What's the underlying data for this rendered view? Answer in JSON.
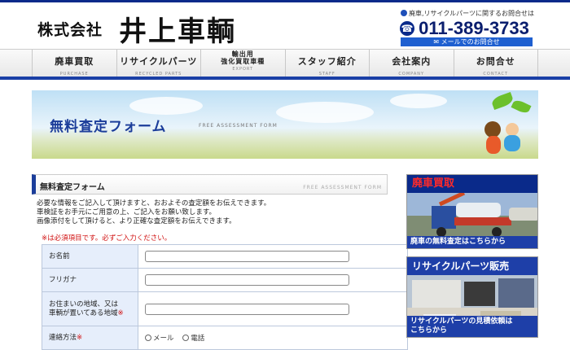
{
  "header": {
    "company_small": "株式会社",
    "company_big": "井上車輌",
    "contact_note": "廃車,リサイクルパーツに関するお問合せは",
    "phone": "011-389-3733",
    "mail_button": "メールでのお問合せ"
  },
  "nav": {
    "items": [
      {
        "jp": "廃車買取",
        "en": "PURCHASE"
      },
      {
        "jp": "リサイクルパーツ",
        "en": "RECYCLED PARTS"
      },
      {
        "jp": "輸出用\n強化買取車種",
        "en": "EXPORT"
      },
      {
        "jp": "スタッフ紹介",
        "en": "STAFF"
      },
      {
        "jp": "会社案内",
        "en": "COMPANY"
      },
      {
        "jp": "お問合せ",
        "en": "CONTACT"
      }
    ]
  },
  "banner": {
    "title": "無料査定フォーム",
    "subtitle": "FREE ASSESSMENT FORM"
  },
  "section": {
    "title": "無料査定フォーム",
    "en": "FREE ASSESSMENT FORM",
    "intro": [
      "必要な情報をご記入して頂けますと、おおよその査定額をお伝えできます。",
      "車検証をお手元にご用意の上、ご記入をお願い致します。",
      "画像添付をして頂けると、より正確な査定額をお伝えできます。"
    ],
    "required_note": "※は必須項目です。必ずご入力ください。"
  },
  "form": {
    "name_label": "お名前",
    "furigana_label": "フリガナ",
    "address_label_1": "お住まいの地域、又は",
    "address_label_2": "車輌が置いてある地域",
    "contact_label": "連絡方法",
    "required_mark": "※",
    "contact_options": [
      "メール",
      "電話"
    ]
  },
  "side": {
    "box1_title": "廃車買取",
    "box1_caption": "廃車の無料査定はこちらから",
    "box2_title": "リサイクルパーツ販売",
    "box2_caption": "リサイクルパーツの見積依頼は\nこちらから"
  },
  "colors": {
    "brand_navy": "#0a2a8a",
    "accent_blue": "#1e3fa8",
    "required_red": "#d01010",
    "form_label_bg": "#e6eefb"
  }
}
